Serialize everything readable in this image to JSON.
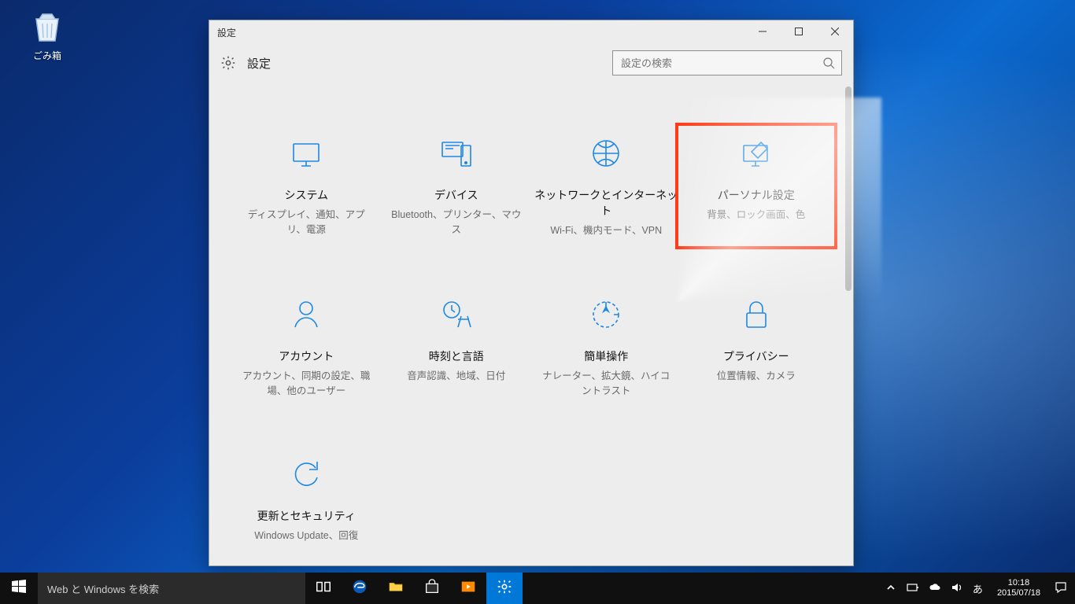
{
  "desktop": {
    "recycle_bin_label": "ごみ箱"
  },
  "window": {
    "title": "設定",
    "header_title": "設定",
    "search_placeholder": "設定の検索"
  },
  "tiles": [
    {
      "key": "system",
      "title": "システム",
      "desc": "ディスプレイ、通知、アプリ、電源"
    },
    {
      "key": "devices",
      "title": "デバイス",
      "desc": "Bluetooth、プリンター、マウス"
    },
    {
      "key": "network",
      "title": "ネットワークとインターネット",
      "desc": "Wi-Fi、機内モード、VPN"
    },
    {
      "key": "personalization",
      "title": "パーソナル設定",
      "desc": "背景、ロック画面、色"
    },
    {
      "key": "accounts",
      "title": "アカウント",
      "desc": "アカウント、同期の設定、職場、他のユーザー"
    },
    {
      "key": "time_language",
      "title": "時刻と言語",
      "desc": "音声認識、地域、日付"
    },
    {
      "key": "ease_of_access",
      "title": "簡単操作",
      "desc": "ナレーター、拡大鏡、ハイコントラスト"
    },
    {
      "key": "privacy",
      "title": "プライバシー",
      "desc": "位置情報、カメラ"
    },
    {
      "key": "update_security",
      "title": "更新とセキュリティ",
      "desc": "Windows Update、回復"
    }
  ],
  "highlighted_tile": "personalization",
  "taskbar": {
    "search_placeholder": "Web と Windows を検索",
    "clock_time": "10:18",
    "clock_date": "2015/07/18"
  },
  "colors": {
    "accent": "#0078d7",
    "icon_blue": "#1e88e5",
    "highlight": "#ff3b18"
  }
}
